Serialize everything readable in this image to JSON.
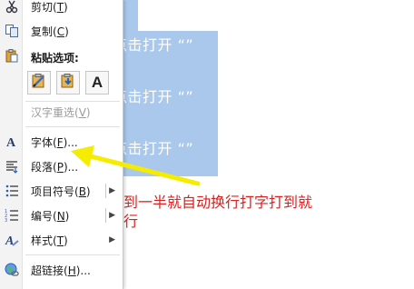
{
  "document": {
    "selected_lines": [
      "点击打开 “”",
      "点击打开 “”",
      "点击打开 “”"
    ],
    "red_line_1": "到一半就自动换行打字打到就",
    "red_line_2": "行"
  },
  "context_menu": {
    "cut": {
      "label": "剪切(",
      "key": "T",
      "tail": ")"
    },
    "copy": {
      "label": "复制(",
      "key": "C",
      "tail": ")"
    },
    "paste_options_heading": "粘贴选项:",
    "paste_buttons": [
      {
        "icon": "keep-source-formatting-icon"
      },
      {
        "icon": "merge-formatting-icon"
      },
      {
        "icon": "keep-text-only-icon",
        "glyph": "A"
      }
    ],
    "reconvert": {
      "label": "汉字重选(",
      "key": "V",
      "tail": ")"
    },
    "font": {
      "label": "字体(",
      "key": "F",
      "tail": ")..."
    },
    "paragraph": {
      "label": "段落(",
      "key": "P",
      "tail": ")..."
    },
    "bullets": {
      "label": "项目符号(",
      "key": "B",
      "tail": ")"
    },
    "numbering": {
      "label": "编号(",
      "key": "N",
      "tail": ")"
    },
    "styles": {
      "label": "样式(",
      "key": "T",
      "tail": ")"
    },
    "hyperlink": {
      "label": "超链接(",
      "key": "H",
      "tail": ")..."
    },
    "submenu_arrow": "▶"
  },
  "colors": {
    "selection": "#a9c8ec",
    "annotation_arrow": "#f5ec00",
    "red_text": "#d82020"
  }
}
